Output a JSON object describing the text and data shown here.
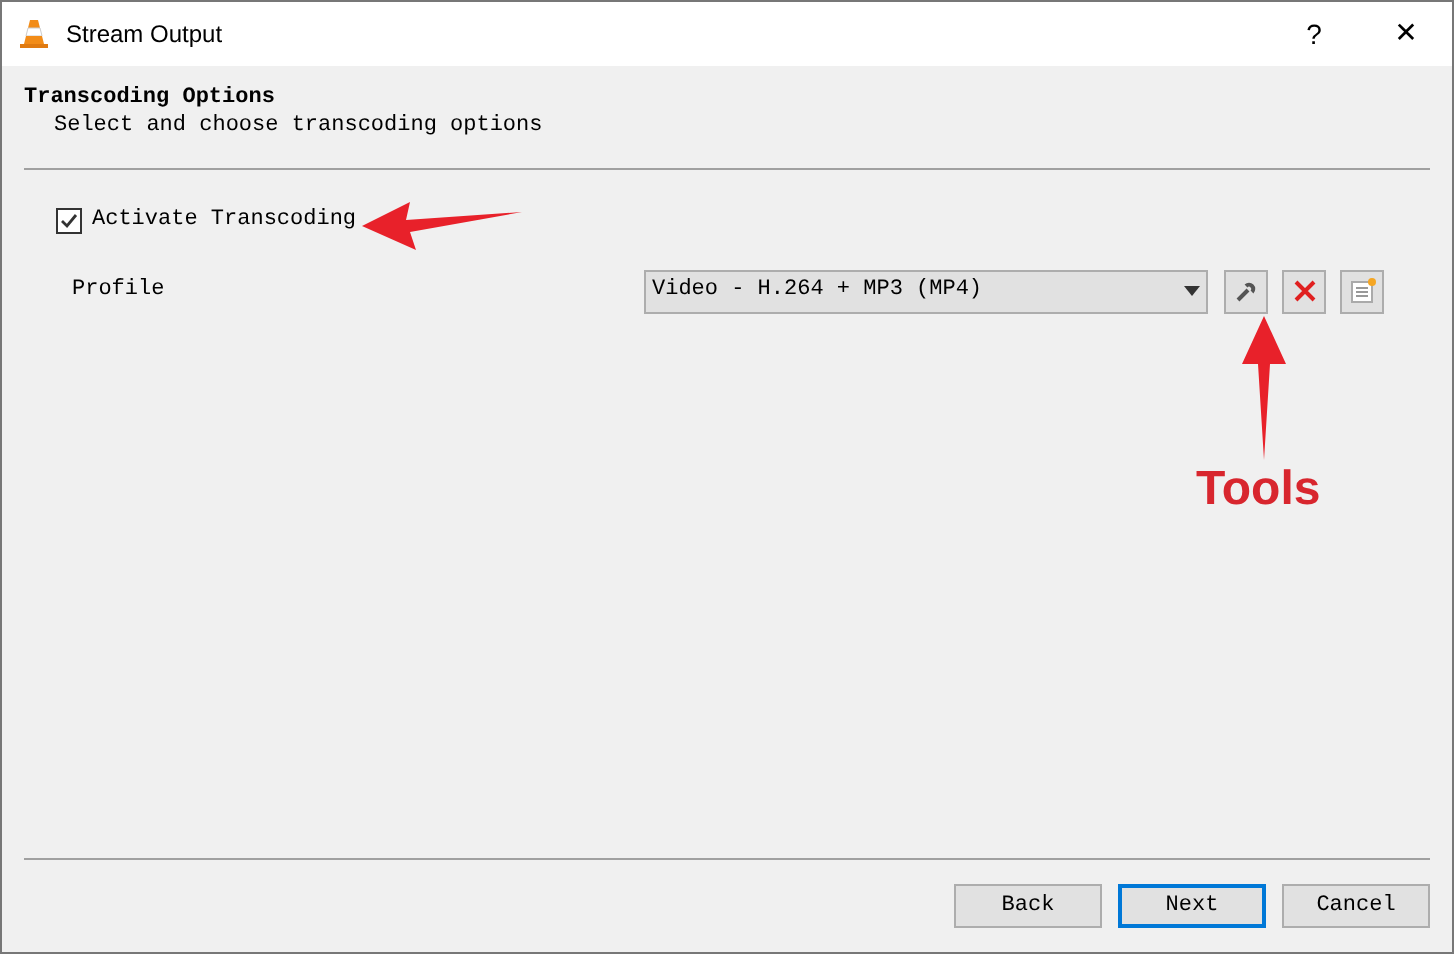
{
  "window": {
    "title": "Stream Output",
    "help": "?",
    "close": "✕"
  },
  "header": {
    "title": "Transcoding Options",
    "subtitle": "Select and choose transcoding options"
  },
  "activate": {
    "label": "Activate Transcoding",
    "checked": true
  },
  "profile": {
    "label": "Profile",
    "value": "Video - H.264 + MP3 (MP4)"
  },
  "tools": [
    {
      "kind": "edit"
    },
    {
      "kind": "delete"
    },
    {
      "kind": "new"
    }
  ],
  "annotations": [
    {
      "kind": "arrow-left"
    },
    {
      "kind": "arrow-up",
      "text": "Tools"
    }
  ],
  "buttons": [
    {
      "label": "Back",
      "default": false
    },
    {
      "label": "Next",
      "default": true
    },
    {
      "label": "Cancel",
      "default": false
    }
  ]
}
